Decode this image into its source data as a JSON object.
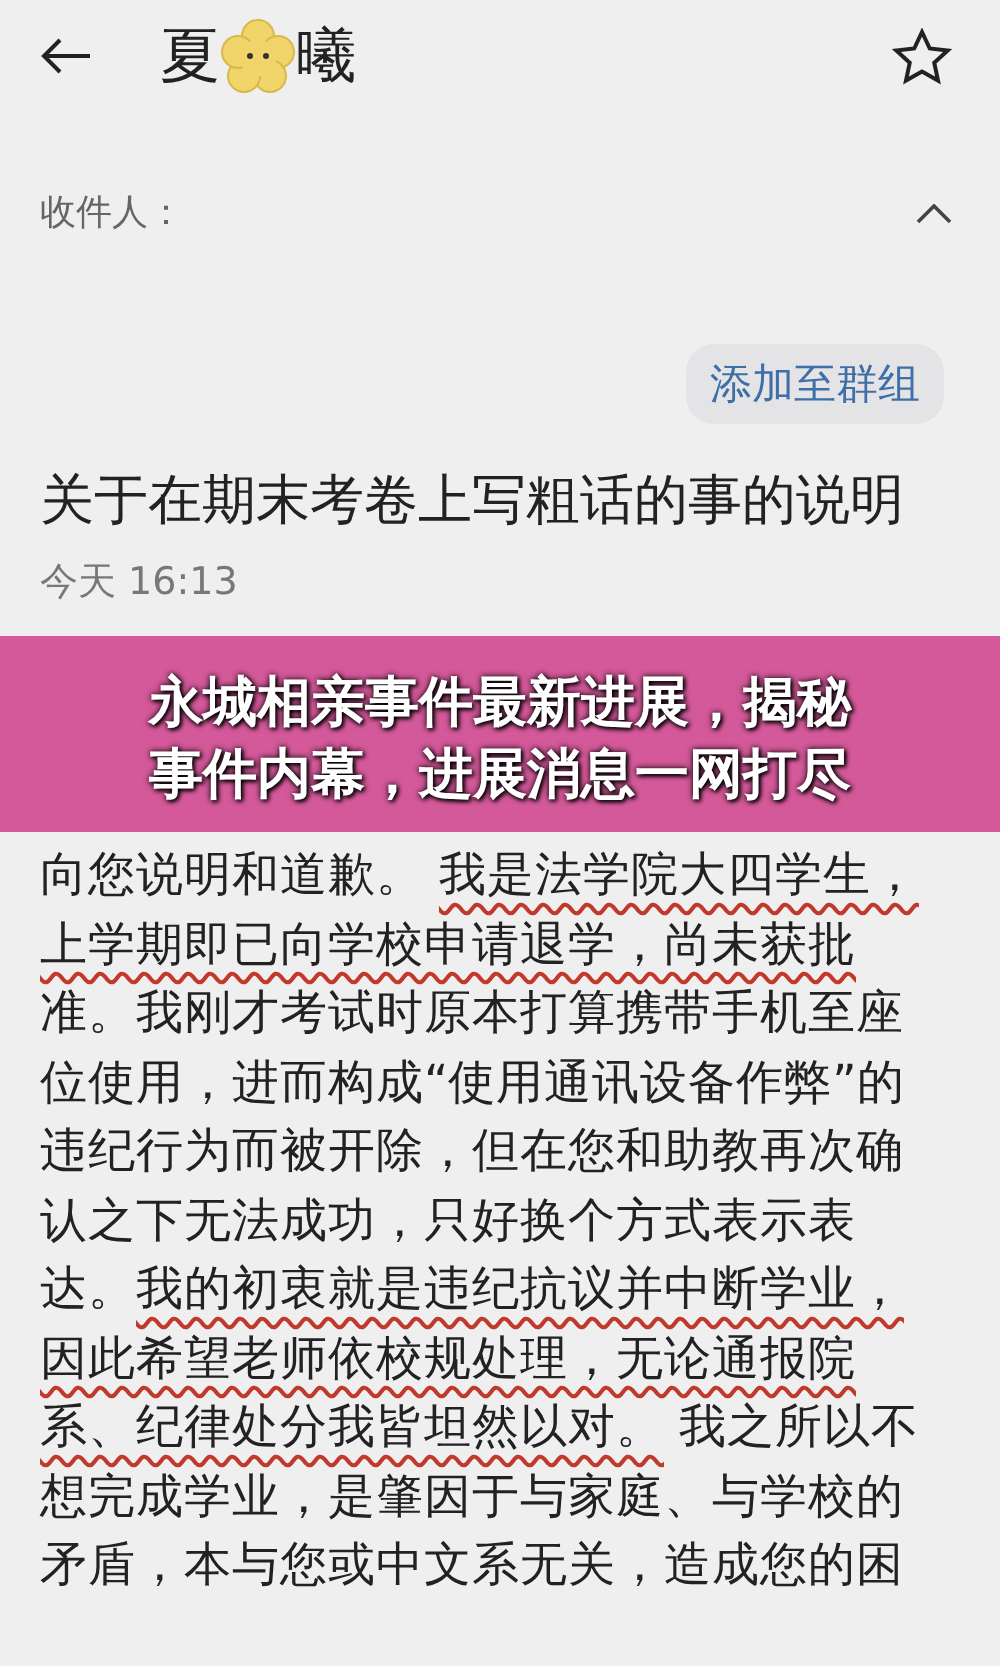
{
  "header": {
    "name_parts": [
      "夏",
      "曦"
    ]
  },
  "recipients": {
    "label": "收件人："
  },
  "add_to_group": "添加至群组",
  "subject": "关于在期末考卷上写粗话的事的说明",
  "time": "今天 16:13",
  "banner": {
    "lines": [
      "永城相亲事件最新进展，揭秘",
      "事件内幕，进展消息一网打尽"
    ]
  },
  "body_lines": [
    [
      {
        "text": "向您说明和道歉。 ",
        "underlined": false
      },
      {
        "text": "我是法学院大四学生，",
        "underlined": true
      }
    ],
    [
      {
        "text": "上学期即已向学校申请退学，尚未获批",
        "underlined": true
      }
    ],
    [
      {
        "text": "准。我刚才考试时原本打算携带手机至座",
        "underlined": false
      }
    ],
    [
      {
        "text": "位使用，进而构成“使用通讯设备作弊”的",
        "underlined": false
      }
    ],
    [
      {
        "text": "违纪行为而被开除，但在您和助教再次确",
        "underlined": false
      }
    ],
    [
      {
        "text": "认之下无法成功，只好换个方式表示表",
        "underlined": false
      }
    ],
    [
      {
        "text": "达。",
        "underlined": false
      },
      {
        "text": "我的初衷就是违纪抗议并中断学业，",
        "underlined": true
      }
    ],
    [
      {
        "text": "因此希望老师依校规处理，无论通报院",
        "underlined": true
      }
    ],
    [
      {
        "text": "系、纪律处分我皆坦然以对。",
        "underlined": true
      },
      {
        "text": " 我之所以不",
        "underlined": false
      }
    ],
    [
      {
        "text": "想完成学业，是肇因于与家庭、与学校的",
        "underlined": false
      }
    ],
    [
      {
        "text": "矛盾，本与您或中文系无关，造成您的困",
        "underlined": false
      }
    ]
  ]
}
